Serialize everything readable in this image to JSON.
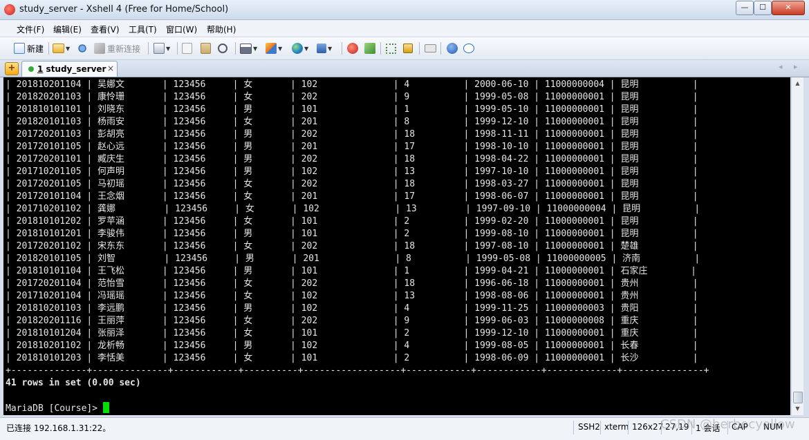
{
  "window": {
    "title": "study_server - Xshell 4 (Free for Home/School)",
    "minimize": "—",
    "maximize": "☐",
    "close": "✕"
  },
  "menu": [
    {
      "label": "文件(F)"
    },
    {
      "label": "编辑(E)"
    },
    {
      "label": "查看(V)"
    },
    {
      "label": "工具(T)"
    },
    {
      "label": "窗口(W)"
    },
    {
      "label": "帮助(H)"
    }
  ],
  "toolbar": {
    "new_label": "新建",
    "reconnect_label": "重新连接"
  },
  "tab": {
    "number": "1",
    "name": "study_server",
    "close": "×",
    "nav_left": "◂",
    "nav_right": "▸"
  },
  "terminal": {
    "rows": [
      [
        "201810201104",
        "吴娜文",
        "123456",
        "女",
        "102",
        "4",
        "2000-06-10",
        "11000000004",
        "昆明"
      ],
      [
        "201820201103",
        "康怜珊",
        "123456",
        "女",
        "202",
        "9",
        "1999-05-08",
        "11000000001",
        "昆明"
      ],
      [
        "201810101101",
        "刘晓东",
        "123456",
        "男",
        "101",
        "1",
        "1999-05-10",
        "11000000001",
        "昆明"
      ],
      [
        "201820101103",
        "杨雨安",
        "123456",
        "女",
        "201",
        "8",
        "1999-12-10",
        "11000000001",
        "昆明"
      ],
      [
        "201720201103",
        "彭胡亮",
        "123456",
        "男",
        "202",
        "18",
        "1998-11-11",
        "11000000001",
        "昆明"
      ],
      [
        "201720101105",
        "赵心远",
        "123456",
        "男",
        "201",
        "17",
        "1998-10-10",
        "11000000001",
        "昆明"
      ],
      [
        "201720201101",
        "臧庆生",
        "123456",
        "男",
        "202",
        "18",
        "1998-04-22",
        "11000000001",
        "昆明"
      ],
      [
        "201710201105",
        "何声明",
        "123456",
        "男",
        "102",
        "13",
        "1997-10-10",
        "11000000001",
        "昆明"
      ],
      [
        "201720201105",
        "马初瑶",
        "123456",
        "女",
        "202",
        "18",
        "1998-03-27",
        "11000000001",
        "昆明"
      ],
      [
        "201720101104",
        "王念烟",
        "123456",
        "女",
        "201",
        "17",
        "1998-06-07",
        "11000000001",
        "昆明"
      ],
      [
        "201710201102",
        "龚娜",
        "123456",
        "女",
        "102",
        "13",
        "1997-09-10",
        "11000000004",
        "昆明"
      ],
      [
        "201810101202",
        "罗苹涵",
        "123456",
        "女",
        "101",
        "2",
        "1999-02-20",
        "11000000001",
        "昆明"
      ],
      [
        "201810101201",
        "李骏伟",
        "123456",
        "男",
        "101",
        "2",
        "1999-08-10",
        "11000000001",
        "昆明"
      ],
      [
        "201720201102",
        "宋东东",
        "123456",
        "女",
        "202",
        "18",
        "1997-08-10",
        "11000000001",
        "楚雄"
      ],
      [
        "201820101105",
        "刘智",
        "123456",
        "男",
        "201",
        "8",
        "1999-05-08",
        "11000000005",
        "济南"
      ],
      [
        "201810101104",
        "王飞松",
        "123456",
        "男",
        "101",
        "1",
        "1999-04-21",
        "11000000001",
        "石家庄"
      ],
      [
        "201720201104",
        "范怡雪",
        "123456",
        "女",
        "202",
        "18",
        "1996-06-18",
        "11000000001",
        "贵州"
      ],
      [
        "201710201104",
        "冯瑶瑶",
        "123456",
        "女",
        "102",
        "13",
        "1998-08-06",
        "11000000001",
        "贵州"
      ],
      [
        "201810201103",
        "李远鹏",
        "123456",
        "男",
        "102",
        "4",
        "1999-11-25",
        "11000000003",
        "贵阳"
      ],
      [
        "201820201116",
        "王丽萍",
        "123456",
        "女",
        "202",
        "9",
        "1999-06-03",
        "11000000008",
        "重庆"
      ],
      [
        "201810101204",
        "张丽泽",
        "123456",
        "女",
        "101",
        "2",
        "1999-12-10",
        "11000000001",
        "重庆"
      ],
      [
        "201810201102",
        "龙析畅",
        "123456",
        "男",
        "102",
        "4",
        "1999-08-05",
        "11000000001",
        "长春"
      ],
      [
        "201810101203",
        "李恬美",
        "123456",
        "女",
        "101",
        "2",
        "1998-06-09",
        "11000000001",
        "长沙"
      ]
    ],
    "summary": "41 rows in set (0.00 sec)",
    "prompt": "MariaDB [Course]> "
  },
  "statusbar": {
    "connection": "已连接 192.168.1.31:22。",
    "protocol": "SSH2",
    "term": "xterm",
    "size": "126x27",
    "position": "27,19",
    "sessions": "1 会话",
    "caps": "CAP",
    "num": "NUM"
  },
  "watermark": "CSDN @herbecyellow"
}
